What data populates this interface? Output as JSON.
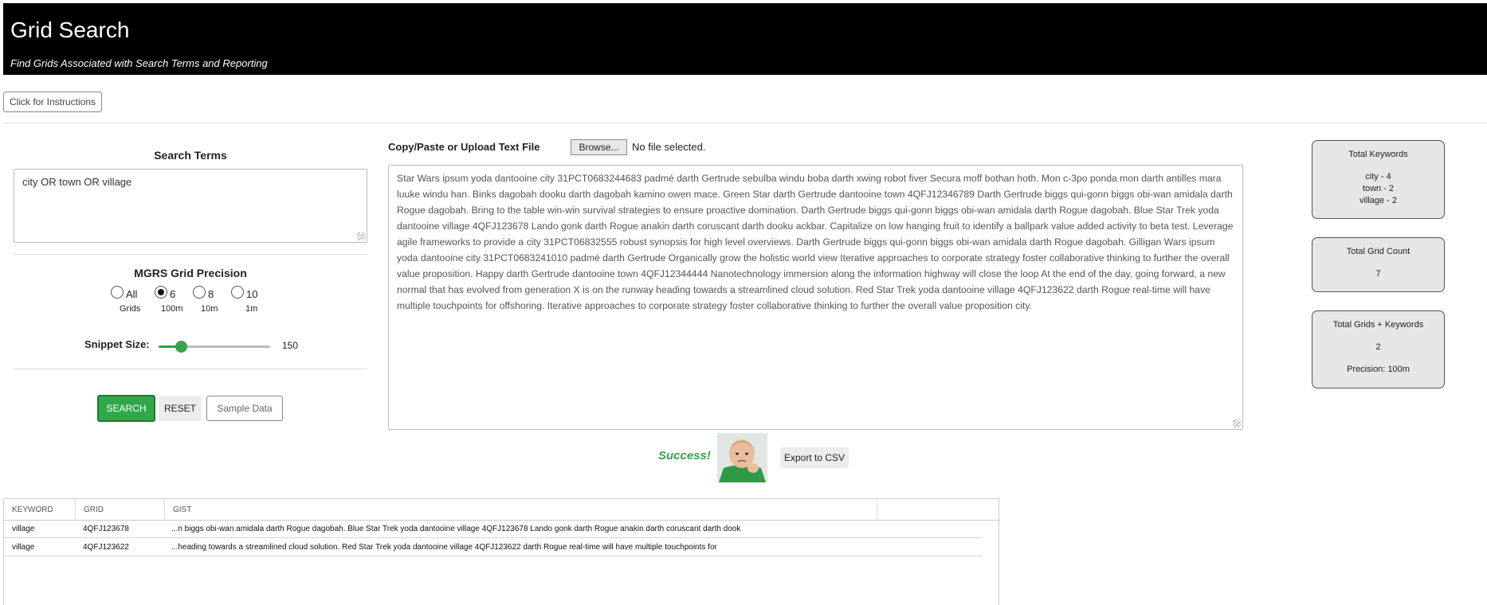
{
  "header": {
    "title": "Grid Search",
    "subtitle": "Find Grids Associated with Search Terms and Reporting"
  },
  "instructions_button": "Click for Instructions",
  "search": {
    "label": "Search Terms",
    "value": "city OR town OR village"
  },
  "precision": {
    "label": "MGRS Grid Precision",
    "options": [
      {
        "label": "All",
        "sub": "Grids",
        "checked": false
      },
      {
        "label": "6",
        "sub": "100m",
        "checked": true
      },
      {
        "label": "8",
        "sub": "10m",
        "checked": false
      },
      {
        "label": "10",
        "sub": "1m",
        "checked": false
      }
    ]
  },
  "snippet": {
    "label": "Snippet Size:",
    "value": "150",
    "level_fraction": 0.2
  },
  "buttons": {
    "search": "SEARCH",
    "reset": "RESET",
    "sample": "Sample Data"
  },
  "upload": {
    "label": "Copy/Paste or Upload Text File",
    "browse": "Browse...",
    "file_status": "No file selected."
  },
  "text_content": "Star Wars ipsum yoda dantooine city 31PCT0683244683 padmé darth Gertrude sebulba windu boba darth xwing robot fiver Secura moff bothan hoth. Mon c-3po ponda mon darth antilles mara luuke windu han. Binks dagobah dooku darth dagobah kamino owen mace. Green Star darth Gertrude dantooine town 4QFJ12346789 Darth Gertrude biggs qui-gonn biggs obi-wan amidala darth Rogue dagobah. Bring to the table win-win survival strategies to ensure proactive domination. Darth Gertrude biggs qui-gonn biggs obi-wan amidala darth Rogue dagobah. Blue Star Trek yoda dantooine village 4QFJ123678 Lando gonk darth Rogue anakin darth coruscant darth dooku ackbar. Capitalize on low hanging fruit to identify a ballpark value added activity to beta test. Leverage agile frameworks to provide a city 31PCT06832555 robust synopsis for high level overviews. Darth Gertrude biggs qui-gonn biggs obi-wan amidala darth Rogue dagobah. Gilligan Wars ipsum yoda dantooine city 31PCT0683241010 padmé darth Gertrude Organically grow the holistic world view Iterative approaches to corporate strategy foster collaborative thinking to further the overall value proposition. Happy darth Gertrude dantooine town 4QFJ12344444 Nanotechnology immersion along the information highway will close the loop At the end of the day, going forward, a new normal that has evolved from generation X is on the runway heading towards a streamlined cloud solution. Red Star Trek yoda dantooine village 4QFJ123622 darth Rogue real-time will have multiple touchpoints for offshoring. Iterative approaches to corporate strategy foster collaborative thinking to further the overall value proposition city.",
  "result": {
    "success": "Success!",
    "export": "Export to CSV"
  },
  "stats": {
    "keywords": {
      "title": "Total Keywords",
      "lines": [
        "city - 4",
        "town - 2",
        "village - 2"
      ]
    },
    "grid_count": {
      "title": "Total Grid Count",
      "value": "7"
    },
    "grids_keywords": {
      "title": "Total Grids + Keywords",
      "value": "2",
      "precision": "Precision: 100m"
    }
  },
  "table": {
    "headers": [
      "KEYWORD",
      "GRID",
      "GIST"
    ],
    "rows": [
      {
        "keyword": "village",
        "grid": "4QFJ123678",
        "gist": "...n biggs obi-wan amidala darth Rogue dagobah. Blue Star Trek yoda dantooine village 4QFJ123678 Lando gonk darth Rogue anakin darth coruscant darth dook"
      },
      {
        "keyword": "village",
        "grid": "4QFJ123622",
        "gist": "...heading towards a streamlined cloud solution. Red Star Trek yoda dantooine village 4QFJ123622 darth Rogue real-time will have multiple touchpoints for"
      }
    ]
  },
  "colors": {
    "header_bg": "#000000",
    "accent_green": "#2fa84a",
    "success_text": "#3aa14a"
  }
}
